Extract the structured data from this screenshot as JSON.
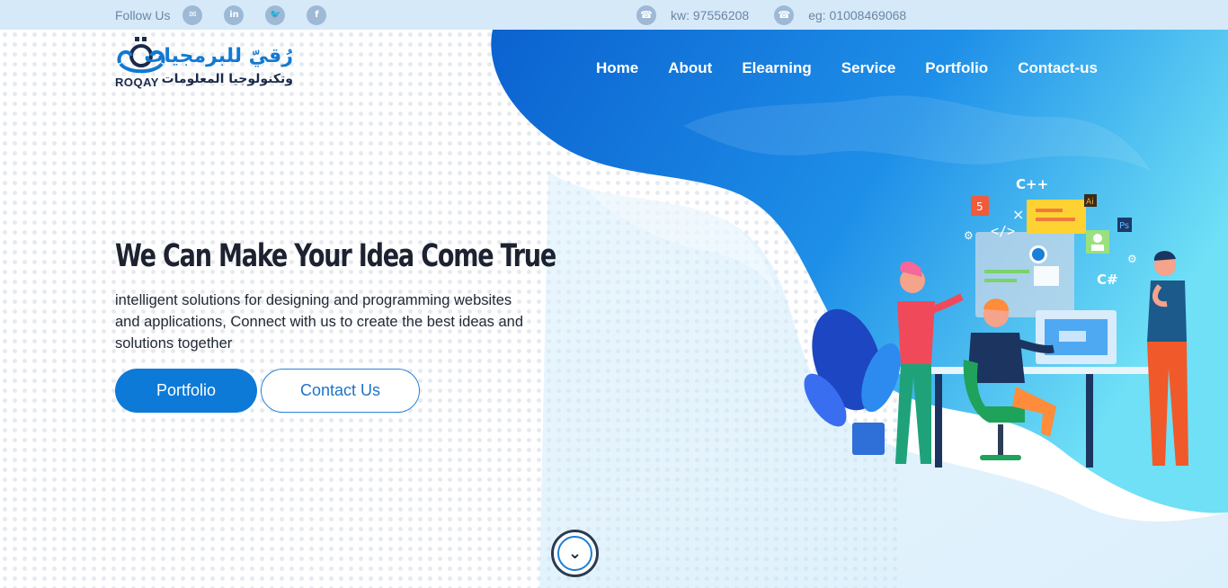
{
  "topbar": {
    "follow_label": "Follow Us",
    "social": [
      {
        "icon": "messenger-icon",
        "glyph": "✉"
      },
      {
        "icon": "linkedin-icon",
        "glyph": "in"
      },
      {
        "icon": "twitter-icon",
        "glyph": "🐦"
      },
      {
        "icon": "facebook-icon",
        "glyph": "f"
      }
    ],
    "contacts": [
      {
        "icon": "phone-icon",
        "text": "kw: 97556208"
      },
      {
        "icon": "phone-icon",
        "text": "eg: 01008469068"
      }
    ]
  },
  "logo": {
    "english": "ROQAY",
    "arabic_line1": "رُقيّ للبرمجيات",
    "arabic_line2": "وتكنولوجيا المعلومات"
  },
  "nav": {
    "items": [
      {
        "label": "Home"
      },
      {
        "label": "About"
      },
      {
        "label": "Elearning"
      },
      {
        "label": "Service"
      },
      {
        "label": "Portfolio"
      },
      {
        "label": "Contact-us"
      }
    ]
  },
  "hero": {
    "title": "We Can Make Your Idea Come True",
    "description": "intelligent solutions for designing and programming websites and applications, Connect with us to create the best ideas and solutions together",
    "primary_button": "Portfolio",
    "secondary_button": "Contact Us"
  },
  "illustration": {
    "labels": [
      "C++",
      "C#",
      "Ai",
      "Ps",
      "5"
    ]
  },
  "colors": {
    "accent": "#0d7ad8",
    "topbar": "#d6e9f8",
    "blob_dark": "#0e6fd6",
    "blob_light": "#4fd0f0"
  }
}
